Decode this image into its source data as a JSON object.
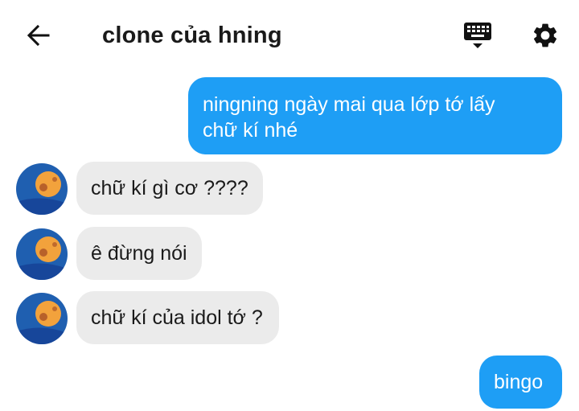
{
  "header": {
    "title": "clone của hning",
    "back_icon": "arrow-left-icon",
    "keyboard_icon": "keyboard-icon",
    "settings_icon": "gear-icon"
  },
  "messages": [
    {
      "side": "outgoing",
      "text_lines": [
        "ningning ngày mai qua lớp tớ lấy",
        "chữ kí nhé"
      ]
    },
    {
      "side": "incoming",
      "text": "chữ kí gì cơ ????"
    },
    {
      "side": "incoming",
      "text": "ê đừng nói"
    },
    {
      "side": "incoming",
      "text": "chữ kí của idol tớ ?"
    },
    {
      "side": "outgoing",
      "text": "bingo"
    }
  ],
  "colors": {
    "outgoing_bubble": "#1e9ef5",
    "incoming_bubble": "#ebebeb",
    "avatar_bg": "#1f5fb0",
    "avatar_fg": "#f2a23c"
  }
}
